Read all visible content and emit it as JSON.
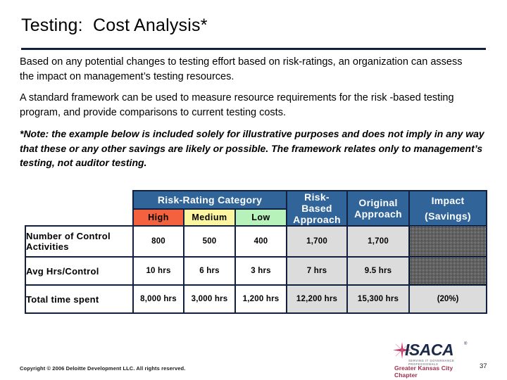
{
  "slide": {
    "title": "Testing:  Cost Analysis*",
    "paragraphs": [
      "Based on any potential changes to testing effort based on risk-ratings, an organization can assess the impact on management’s testing resources.",
      "A standard framework can be used to measure resource requirements for the risk -based testing program, and provide comparisons to current testing costs."
    ],
    "note": "*Note:  the example below is included solely for illustrative purposes and does not imply in any way that these or any other savings are likely or possible. The framework relates only to management’s testing, not auditor testing."
  },
  "table": {
    "group_header": "Risk-Rating Category",
    "sub_headers": [
      "High",
      "Medium",
      "Low"
    ],
    "other_headers": {
      "risk_based": "Risk-\nBased\nApproach",
      "original": "Original\nApproach",
      "impact_top": "Impact",
      "impact_bottom": "(Savings)"
    },
    "rows": [
      {
        "label": "Number of Control Activities",
        "high": "800",
        "medium": "500",
        "low": "400",
        "risk_based": "1,700",
        "original": "1,700",
        "impact": ""
      },
      {
        "label": "Avg Hrs/Control",
        "high": "10 hrs",
        "medium": "6 hrs",
        "low": "3 hrs",
        "risk_based": "7 hrs",
        "original": "9.5 hrs",
        "impact": ""
      },
      {
        "label": "Total time spent",
        "high": "8,000 hrs",
        "medium": "3,000 hrs",
        "low": "1,200 hrs",
        "risk_based": "12,200 hrs",
        "original": "15,300 hrs",
        "impact": "(20%)"
      }
    ]
  },
  "footer": {
    "copyright": "Copyright © 2006 Deloitte Development LLC. All rights reserved.",
    "slide_number": "37"
  },
  "logo": {
    "word": "ISACA",
    "registered": "®",
    "tagline": "SERVING IT GOVERNANCE PROFESSIONALS",
    "chapter": "Greater Kansas City Chapter"
  },
  "colors": {
    "header_blue": "#31659a",
    "rule_navy": "#11203f",
    "high": "#f4613e",
    "medium": "#fdf6a0",
    "low": "#b6f2ba",
    "gray_cell": "#dcdcdc",
    "logo_navy": "#1b2a4a",
    "logo_magenta": "#c0396b"
  }
}
